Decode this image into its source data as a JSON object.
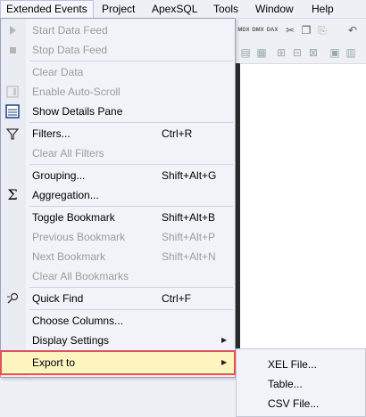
{
  "menubar": {
    "items": [
      {
        "label": "Extended Events"
      },
      {
        "label": "Project"
      },
      {
        "label": "ApexSQL"
      },
      {
        "label": "Tools"
      },
      {
        "label": "Window"
      },
      {
        "label": "Help"
      }
    ]
  },
  "toolbar": {
    "mdx_label": "MDX",
    "dmx_label": "DMX",
    "dax_label": "DAX"
  },
  "menu": {
    "start_data_feed": "Start Data Feed",
    "stop_data_feed": "Stop Data Feed",
    "clear_data": "Clear Data",
    "enable_auto_scroll": "Enable Auto-Scroll",
    "show_details_pane": "Show Details Pane",
    "filters": "Filters...",
    "filters_shortcut": "Ctrl+R",
    "clear_all_filters": "Clear All Filters",
    "grouping": "Grouping...",
    "grouping_shortcut": "Shift+Alt+G",
    "aggregation": "Aggregation...",
    "toggle_bookmark": "Toggle Bookmark",
    "toggle_bookmark_shortcut": "Shift+Alt+B",
    "previous_bookmark": "Previous Bookmark",
    "previous_bookmark_shortcut": "Shift+Alt+P",
    "next_bookmark": "Next Bookmark",
    "next_bookmark_shortcut": "Shift+Alt+N",
    "clear_all_bookmarks": "Clear All Bookmarks",
    "quick_find": "Quick Find",
    "quick_find_shortcut": "Ctrl+F",
    "choose_columns": "Choose Columns...",
    "display_settings": "Display Settings",
    "export_to": "Export to"
  },
  "submenu": {
    "xel_file": "XEL File...",
    "table": "Table...",
    "csv_file": "CSV File..."
  },
  "colors": {
    "highlight_bg": "#fdf4bf",
    "highlight_border": "#e05555",
    "disabled_text": "#9c9c9c"
  }
}
